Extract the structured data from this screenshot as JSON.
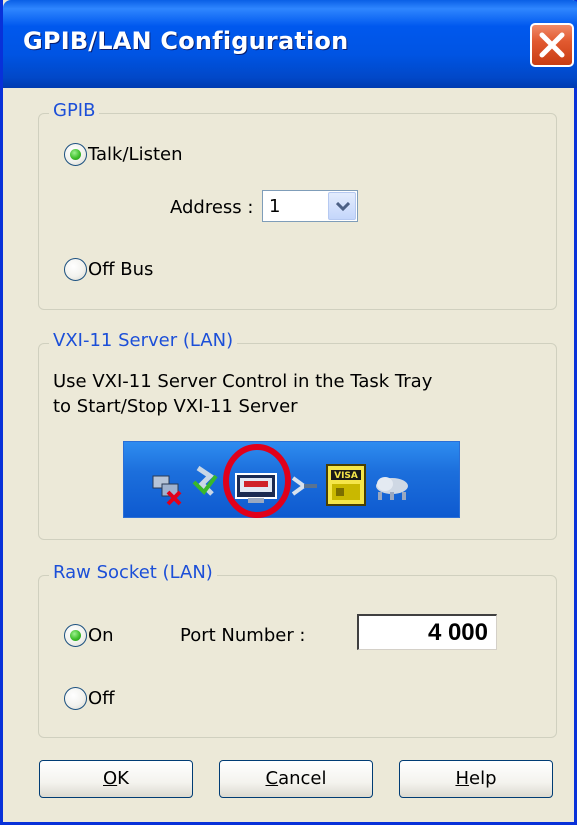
{
  "window": {
    "title": "GPIB/LAN Configuration",
    "close_icon": "close-x-icon"
  },
  "gpib": {
    "group_label": "GPIB",
    "talk_listen_label": "Talk/Listen",
    "talk_listen_checked": true,
    "address_label": "Address :",
    "address_value": "1",
    "off_bus_label": "Off Bus",
    "off_bus_checked": false
  },
  "vxi11": {
    "group_label": "VXI-11 Server (LAN)",
    "instruction_line1": "Use VXI-11 Server Control in the Task Tray",
    "instruction_line2": "to Start/Stop VXI-11 Server",
    "tray_icons": [
      "network-disconnected-icon",
      "safely-remove-icon",
      "vxi11-server-icon",
      "network-cable-icon",
      "visa-icon",
      "cloud-network-icon"
    ],
    "highlighted_icon": "vxi11-server-icon",
    "highlight_color": "#e0001a"
  },
  "raw_socket": {
    "group_label": "Raw Socket (LAN)",
    "on_label": "On",
    "on_checked": true,
    "port_label": "Port Number :",
    "port_value": "4 000",
    "off_label": "Off",
    "off_checked": false
  },
  "buttons": {
    "ok": {
      "accel": "O",
      "rest": "K"
    },
    "cancel": {
      "accel": "C",
      "rest": "ancel"
    },
    "help": {
      "accel": "H",
      "rest": "elp"
    }
  },
  "colors": {
    "title_bar": "#0054e3",
    "dialog_bg": "#ece9d8",
    "group_label": "#1c4fd8",
    "radio_checked": "#3fbf2c"
  }
}
